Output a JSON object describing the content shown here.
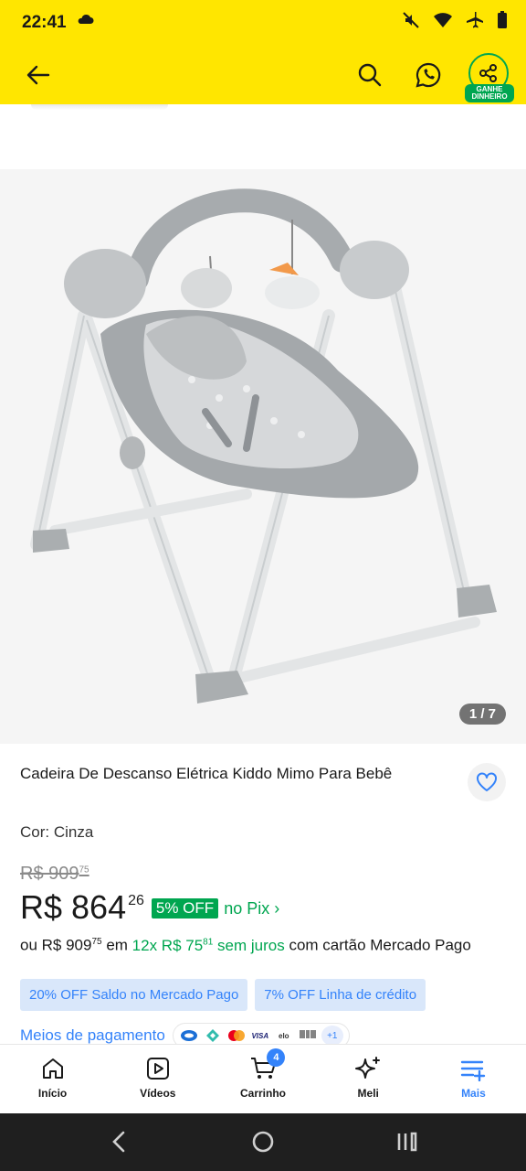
{
  "status_bar": {
    "time": "22:41"
  },
  "header": {
    "earn_badge": "GANHE DINHEIRO"
  },
  "gallery": {
    "counter": "1 / 7"
  },
  "product": {
    "title": "Cadeira De Descanso Elétrica Kiddo Mimo Para Bebê",
    "variant_label": "Cor:",
    "variant_value": "Cinza",
    "old_price": "R$ 909",
    "old_price_cents": "75",
    "price": "R$ 864",
    "price_cents": "26",
    "discount_badge": "5% OFF",
    "pix_label": "no Pix ›",
    "installments": {
      "prefix": "ou R$ 909",
      "prefix_cents": "75",
      "em": "em",
      "plan": "12x R$ 75",
      "plan_cents": "81",
      "no_interest": "sem juros",
      "suffix": "com cartão Mercado Pago"
    },
    "chips": [
      "20% OFF Saldo no Mercado Pago",
      "7% OFF Linha de crédito"
    ],
    "payment_methods_label": "Meios de pagamento",
    "payment_icons": [
      "bank-icon",
      "pix-icon",
      "mastercard-icon",
      "VISA",
      "elo",
      "boleto-icon"
    ],
    "payment_more": "+1"
  },
  "bottom_nav": [
    {
      "label": "Início",
      "icon": "home-icon"
    },
    {
      "label": "Vídeos",
      "icon": "video-icon"
    },
    {
      "label": "Carrinho",
      "icon": "cart-icon",
      "badge": "4"
    },
    {
      "label": "Meli",
      "icon": "sparkle-icon"
    },
    {
      "label": "Mais",
      "icon": "menu-plus-icon",
      "active": true
    }
  ],
  "colors": {
    "header": "#ffe600",
    "accent_blue": "#3483fa",
    "green": "#00a650"
  }
}
